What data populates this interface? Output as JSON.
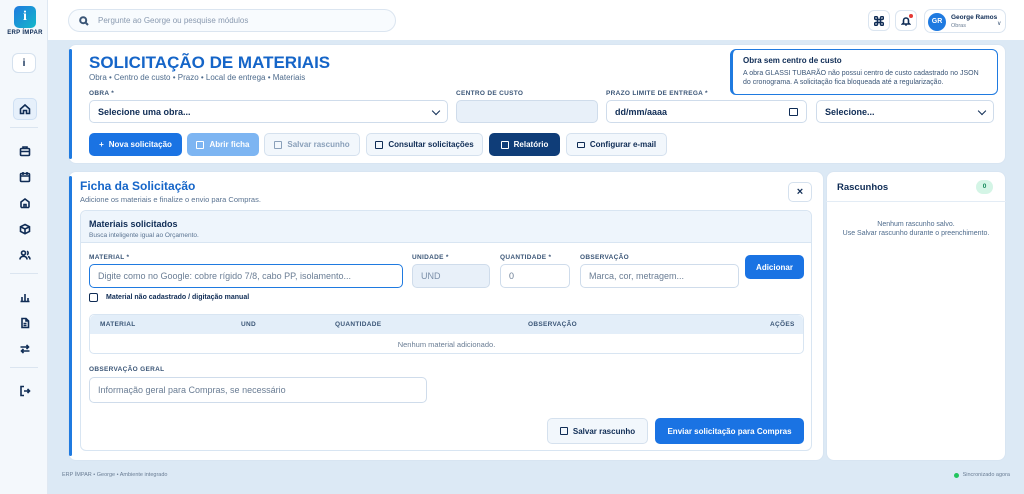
{
  "app": {
    "name": "ERP ÍMPAR",
    "logo_letter": "i",
    "user_initial": "i"
  },
  "topbar": {
    "search_placeholder": "Pergunte ao George ou pesquise módulos",
    "user": {
      "initials": "GR",
      "name": "George Ramos",
      "role": "Obras",
      "chevron": "∨"
    }
  },
  "sidebar": {
    "icons": [
      "home-icon",
      "briefcase-icon",
      "calendar-icon",
      "building-icon",
      "box-icon",
      "users-icon",
      "bar-chart-icon",
      "document-icon",
      "transfer-icon",
      "logout-icon"
    ]
  },
  "header": {
    "title": "SOLICITAÇÃO DE MATERIAIS",
    "breadcrumb": "Obra • Centro de custo • Prazo • Local de entrega • Materiais",
    "obra_label": "OBRA *",
    "obra_value": "Selecione uma obra...",
    "centro_label": "CENTRO DE CUSTO",
    "prazo_label": "PRAZO LIMITE DE ENTREGA *",
    "prazo_value": "dd/mm/aaaa",
    "local_value": "Selecione..."
  },
  "toolbar": {
    "nova": "Nova solicitação",
    "abrir": "Abrir ficha",
    "salvar": "Salvar rascunho",
    "consultar": "Consultar solicitações",
    "relatorio": "Relatório",
    "email": "Configurar e-mail"
  },
  "toast": {
    "title": "Obra sem centro de custo",
    "message": "A obra GLASSI TUBARÃO não possui centro de custo cadastrado no JSON do cronograma. A solicitação fica bloqueada até a regularização."
  },
  "ficha": {
    "title": "Ficha da Solicitação",
    "subtitle": "Adicione os materiais e finalize o envio para Compras.",
    "close": "×",
    "section_title": "Materiais solicitados",
    "section_sub": "Busca inteligente igual ao Orçamento.",
    "material_label": "MATERIAL *",
    "material_placeholder": "Digite como no Google: cobre rígido 7/8, cabo PP, isolamento...",
    "unidade_label": "UNIDADE *",
    "unidade_value": "UND",
    "quantidade_label": "QUANTIDADE *",
    "quantidade_value": "0",
    "observacao_label": "OBSERVAÇÃO",
    "observacao_placeholder": "Marca, cor, metragem...",
    "add_button": "Adicionar",
    "manual_label": "Material não cadastrado / digitação manual",
    "table_headers": [
      "MATERIAL",
      "UND",
      "QUANTIDADE",
      "OBSERVAÇÃO",
      "AÇÕES"
    ],
    "table_empty": "Nenhum material adicionado.",
    "obs_geral_label": "OBSERVAÇÃO GERAL",
    "obs_geral_placeholder": "Informação geral para Compras, se necessário",
    "save_draft": "Salvar rascunho",
    "send": "Enviar solicitação para Compras"
  },
  "rascunhos": {
    "title": "Rascunhos",
    "count": "0",
    "empty1": "Nenhum rascunho salvo.",
    "empty2": "Use Salvar rascunho durante o preenchimento."
  },
  "footer": {
    "left": "ERP ÍMPAR • George • Ambiente integrado",
    "right": "Sincronizado agora"
  }
}
